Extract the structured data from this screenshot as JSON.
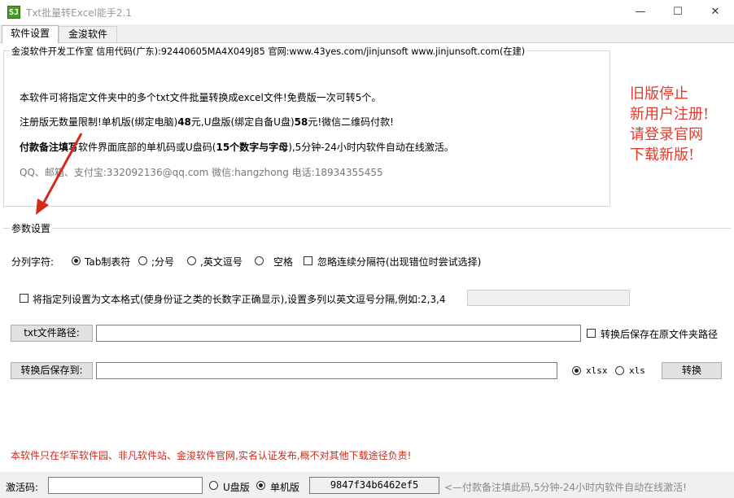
{
  "window": {
    "icon_text": "SJ",
    "title": "Txt批量转Excel能手2.1",
    "minimize": "—",
    "maximize": "☐",
    "close": "✕"
  },
  "tabs": [
    {
      "label": "软件设置"
    },
    {
      "label": "金浚软件"
    }
  ],
  "info": {
    "group_title": "金浚软件开发工作室 信用代码(广东):92440605MA4X049J85 官网:www.43yes.com/jinjunsoft  www.jinjunsoft.com(在建)",
    "line1": "本软件可将指定文件夹中的多个txt文件批量转换成excel文件!免费版一次可转5个。",
    "line2_a": "注册版无数量限制!单机版(绑定电脑)",
    "line2_b": "48",
    "line2_c": "元,U盘版(绑定自备U盘)",
    "line2_d": "58",
    "line2_e": "元!微信二维码付款!",
    "line3_a": "付款备注填写",
    "line3_b": "软件界面底部的单机码或U盘码(",
    "line3_c": "15个数字与字母",
    "line3_d": "),5分钟-24小时内软件自动在线激活。",
    "line4": "QQ、邮箱、支付宝:332092136@qq.com  微信:hangzhong  电话:18934355455"
  },
  "notice": {
    "line1": "旧版停止",
    "line2": "新用户注册!",
    "line3": "请登录官网",
    "line4": "下载新版!",
    "color": "#e23a2a"
  },
  "params": {
    "group_title": "参数设置",
    "separator_label": "分列字符:",
    "options": [
      {
        "label": "Tab制表符",
        "selected": true
      },
      {
        "label": ";分号",
        "selected": false
      },
      {
        "label": ",英文逗号",
        "selected": false
      },
      {
        "label": "空格",
        "selected": false
      }
    ],
    "ignore_consecutive": "忽略连续分隔符(出现错位时尝试选择)",
    "text_format_label": "将指定列设置为文本格式(使身份证之类的长数字正确显示),设置多列以英文逗号分隔,例如:2,3,4",
    "txt_path_button": "txt文件路径:",
    "txt_path_value": "",
    "save_in_original": "转换后保存在原文件夹路径",
    "save_to_button": "转换后保存到:",
    "save_to_value": "",
    "format_xlsx": "xlsx",
    "format_xls": "xls",
    "convert_button": "转换"
  },
  "footer_warning": "本软件只在华军软件园、非凡软件站、金浚软件官网,实名认证发布,概不对其他下载途径负责!",
  "activation": {
    "label": "激活码:",
    "value": "",
    "usb_label": "U盘版",
    "standalone_label": "单机版",
    "machine_code": "9847f34b6462ef5",
    "hint": "<—付款备注填此码,5分钟-24小时内软件自动在线激活!"
  }
}
